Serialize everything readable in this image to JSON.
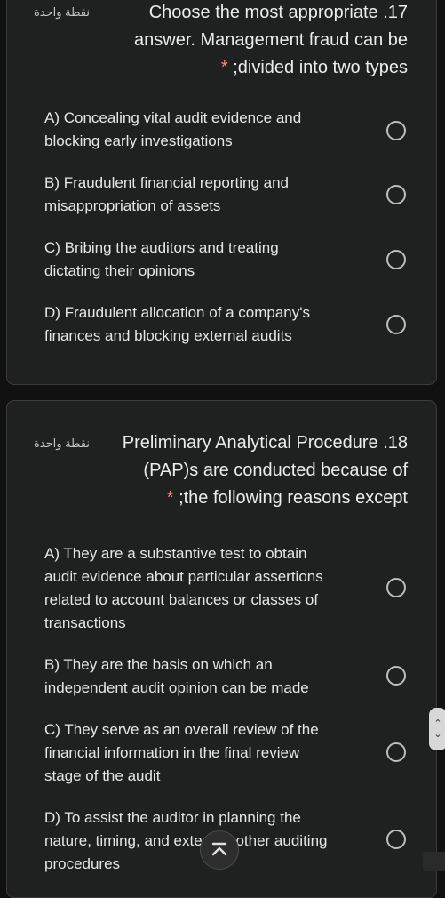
{
  "questions": [
    {
      "points": "نقطة واحدة",
      "title_lines": [
        "Choose the most appropriate .17",
        "answer. Management fraud can be",
        ";divided into two types"
      ],
      "required_mark": "*",
      "options": [
        {
          "lines": [
            "A) Concealing vital audit evidence and",
            "blocking early investigations"
          ]
        },
        {
          "lines": [
            "B) Fraudulent financial reporting and",
            "misappropriation of assets"
          ]
        },
        {
          "lines": [
            "C) Bribing the auditors and treating",
            "dictating their opinions"
          ]
        },
        {
          "lines": [
            "D) Fraudulent allocation of a company's",
            "finances and blocking external audits"
          ]
        }
      ]
    },
    {
      "points": "نقطة واحدة",
      "title_lines": [
        "Preliminary Analytical Procedure .18",
        "(PAP)s are conducted because of",
        ";the following reasons except"
      ],
      "required_mark": "*",
      "options": [
        {
          "lines": [
            "A) They are a substantive test to obtain",
            "audit evidence about particular assertions",
            "related to account balances or classes of",
            "transactions"
          ]
        },
        {
          "lines": [
            "B) They are the basis on which an",
            "independent audit opinion can be made"
          ]
        },
        {
          "lines": [
            "C) They serve as an overall review of the",
            "financial information in the final review",
            "stage of the audit"
          ]
        },
        {
          "lines": [
            "D) To assist the auditor in planning the",
            "nature, timing, and extent of other auditing",
            "procedures"
          ]
        }
      ]
    }
  ],
  "icons": {
    "scroll_top": "chevron-up-to-top-icon",
    "side_handle": "chevron-up-down-icon"
  }
}
